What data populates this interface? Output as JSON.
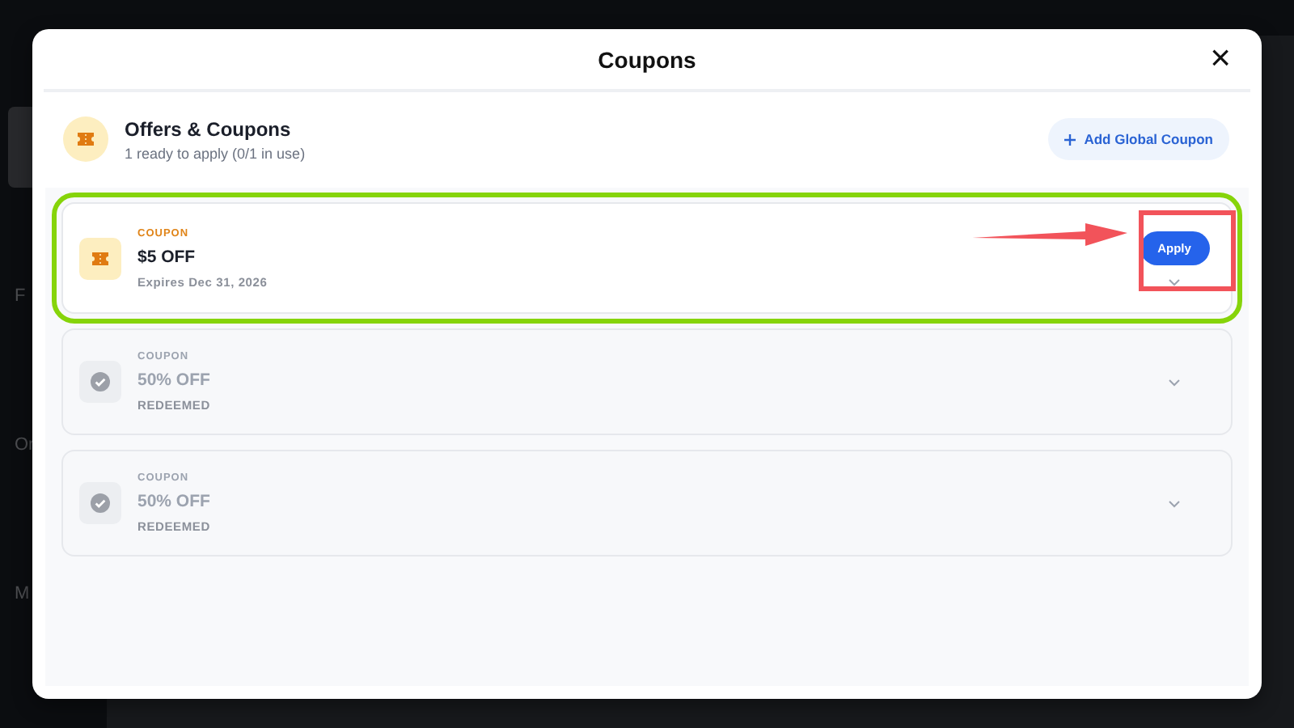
{
  "app": {
    "sidebar": [
      {
        "label": "F"
      },
      {
        "label": "Or"
      },
      {
        "label": "M"
      }
    ]
  },
  "modal": {
    "title": "Coupons",
    "close": "×",
    "summary": {
      "title": "Offers & Coupons",
      "subtitle": "1 ready to apply (0/1 in use)",
      "add_button": "Add Global Coupon"
    },
    "coupons": [
      {
        "kind": "active",
        "tag": "COUPON",
        "title": "$5 OFF",
        "detail": "Expires Dec 31, 2026",
        "action": "Apply",
        "highlighted": true
      },
      {
        "kind": "redeemed",
        "tag": "COUPON",
        "title": "50% OFF",
        "detail": "REDEEMED",
        "highlighted": false
      },
      {
        "kind": "redeemed",
        "tag": "COUPON",
        "title": "50% OFF",
        "detail": "REDEEMED",
        "highlighted": false
      }
    ]
  }
}
